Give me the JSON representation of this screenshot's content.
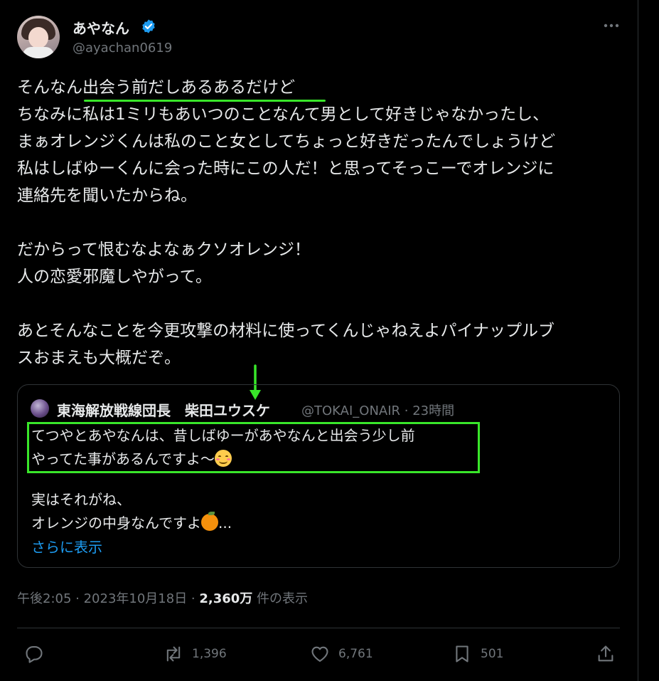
{
  "tweet": {
    "author": {
      "display_name": "あやなん",
      "handle": "@ayachan0619",
      "verified_icon": "verified-badge-icon"
    },
    "text": "そんなん出会う前だしあるあるだけど\nちなみに私は1ミリもあいつのことなんて男として好きじゃなかったし、\nまぁオレンジくんは私のこと女としてちょっと好きだったんでしょうけど\n私はしばゆーくんに会った時にこの人だ！と思ってそっこーでオレンジに\n連絡先を聞いたからね。\n\nだからって恨むなよなぁクソオレンジ！\n人の恋愛邪魔しやがって。\n\nあとそんなことを今更攻撃の材料に使ってくんじゃねえよパイナップルブ\nスおまえも大概だぞ。",
    "timestamp": "午後2:05 · 2023年10月18日 · ",
    "views_count": "2,360万",
    "views_label": " 件の表示"
  },
  "quote": {
    "display_name": "東海解放戦線団長　柴田ユウスケ",
    "meta": "@TOKAI_ONAIR · 23時間",
    "text_highlighted": "てつやとあやなんは、昔しばゆーがあやなんと出会う少し前\nやってた事があるんですよ〜",
    "text_rest_line1": "実はそれがね、",
    "text_rest_line2": "オレンジの中身なんですよ",
    "ellipsis": "...",
    "show_more": "さらに表示"
  },
  "actions": {
    "reply": {
      "icon": "reply-icon",
      "count": ""
    },
    "retweet": {
      "icon": "retweet-icon",
      "count": "1,396"
    },
    "like": {
      "icon": "heart-icon",
      "count": "6,761"
    },
    "bookmark": {
      "icon": "bookmark-icon",
      "count": "501"
    },
    "share": {
      "icon": "share-icon",
      "count": ""
    }
  },
  "colors": {
    "background": "#000000",
    "text": "#e7e9ea",
    "muted": "#71767b",
    "link": "#1d9bf0",
    "border": "#2f3336",
    "annotation_green": "#39e62a"
  }
}
